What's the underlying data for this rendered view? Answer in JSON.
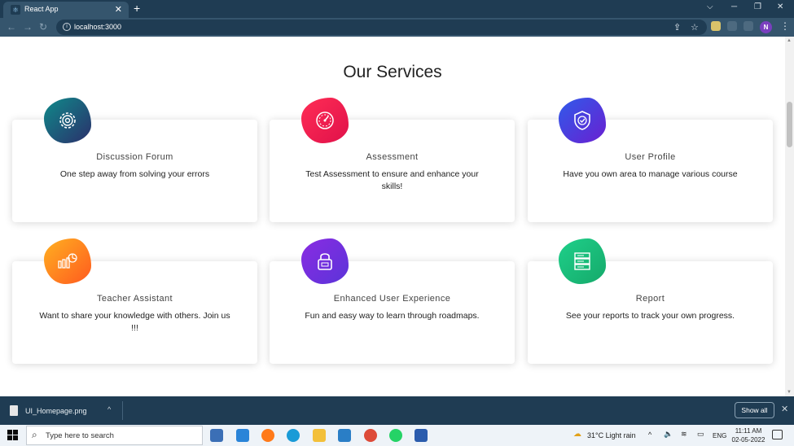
{
  "browser": {
    "tab_title": "React App",
    "tab_close": "✕",
    "new_tab": "+",
    "url": "localhost:3000",
    "profile_initial": "N",
    "window_controls": {
      "caret": "⌵",
      "minimize": "─",
      "restore": "❐",
      "close": "✕"
    },
    "nav": {
      "back": "←",
      "forward": "→",
      "reload": "↻"
    },
    "icons": [
      "share-icon",
      "star-icon",
      "extension-icon",
      "puzzle-icon",
      "reading-list-icon"
    ]
  },
  "page": {
    "section_title": "Our Services",
    "services": [
      {
        "title": "Discussion Forum",
        "desc": "One step away from solving your errors",
        "icon": "gear-icon",
        "colors": [
          "#0f8a8a",
          "#2b2f6b"
        ]
      },
      {
        "title": "Assessment",
        "desc": "Test Assessment to ensure and enhance your skills!",
        "icon": "speedometer-icon",
        "colors": [
          "#ff2d55",
          "#e0114a"
        ]
      },
      {
        "title": "User Profile",
        "desc": "Have you own area to manage various course",
        "icon": "shield-icon",
        "colors": [
          "#2f5bea",
          "#6a1fd1"
        ]
      },
      {
        "title": "Teacher Assistant",
        "desc": "Want to share your knowledge with others. Join us !!!",
        "icon": "chart-presentation-icon",
        "colors": [
          "#ffb020",
          "#ff5a1f"
        ]
      },
      {
        "title": "Enhanced User Experience",
        "desc": "Fun and easy way to learn through roadmaps.",
        "icon": "lock-icon",
        "colors": [
          "#8a2be2",
          "#5b34d9"
        ]
      },
      {
        "title": "Report",
        "desc": "See your reports to track your own progress.",
        "icon": "server-icon",
        "colors": [
          "#1fd08a",
          "#15a96a"
        ]
      }
    ]
  },
  "downloads": {
    "file_name": "UI_Homepage.png",
    "caret": "^",
    "show_all": "Show all",
    "close": "✕"
  },
  "taskbar": {
    "search_placeholder": "Type here to search",
    "weather": "31°C  Light rain",
    "tray_caret": "^",
    "language": "ENG",
    "time": "11:11 AM",
    "date": "02-05-2022",
    "apps": [
      "task-view-icon",
      "mail-icon",
      "firefox-icon",
      "edge-icon",
      "file-explorer-icon",
      "vscode-icon",
      "chrome-icon",
      "whatsapp-icon",
      "word-icon"
    ]
  }
}
